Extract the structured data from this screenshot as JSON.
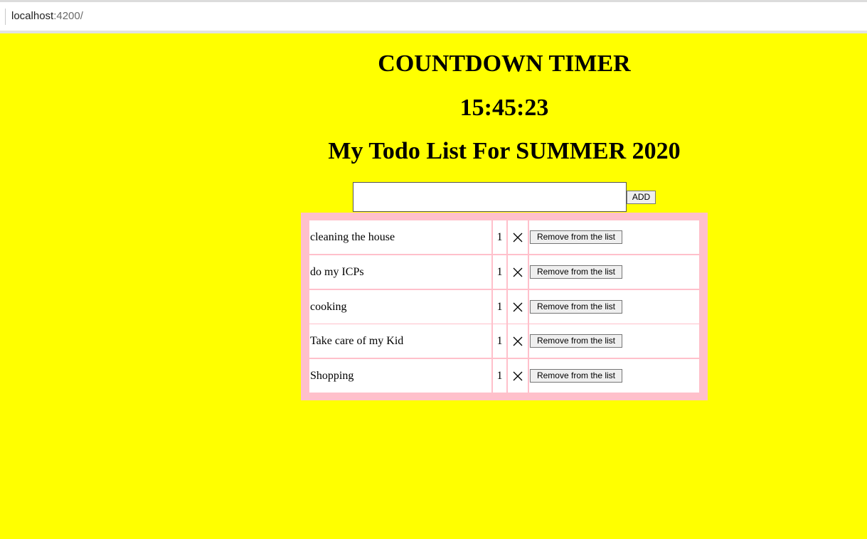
{
  "browser": {
    "url_host": "localhost",
    "url_path": ":4200/"
  },
  "header": {
    "title": "COUNTDOWN TIMER",
    "timer": "15:45:23",
    "list_title": "My Todo List For SUMMER 2020"
  },
  "form": {
    "input_value": "",
    "add_label": "ADD"
  },
  "todos": [
    {
      "text": "cleaning the house",
      "count": "1",
      "action": "Remove from the list"
    },
    {
      "text": "do my ICPs",
      "count": "1",
      "action": "Remove from the list"
    },
    {
      "text": "cooking",
      "count": "1",
      "action": "Remove from the list"
    },
    {
      "text": "Take care of my Kid",
      "count": "1",
      "action": "Remove from the list"
    },
    {
      "text": "Shopping",
      "count": "1",
      "action": "Remove from the list"
    }
  ],
  "colors": {
    "page_background": "#ffff00",
    "table_background": "#ffc0cb"
  },
  "icons": {
    "delete": "close-icon"
  }
}
